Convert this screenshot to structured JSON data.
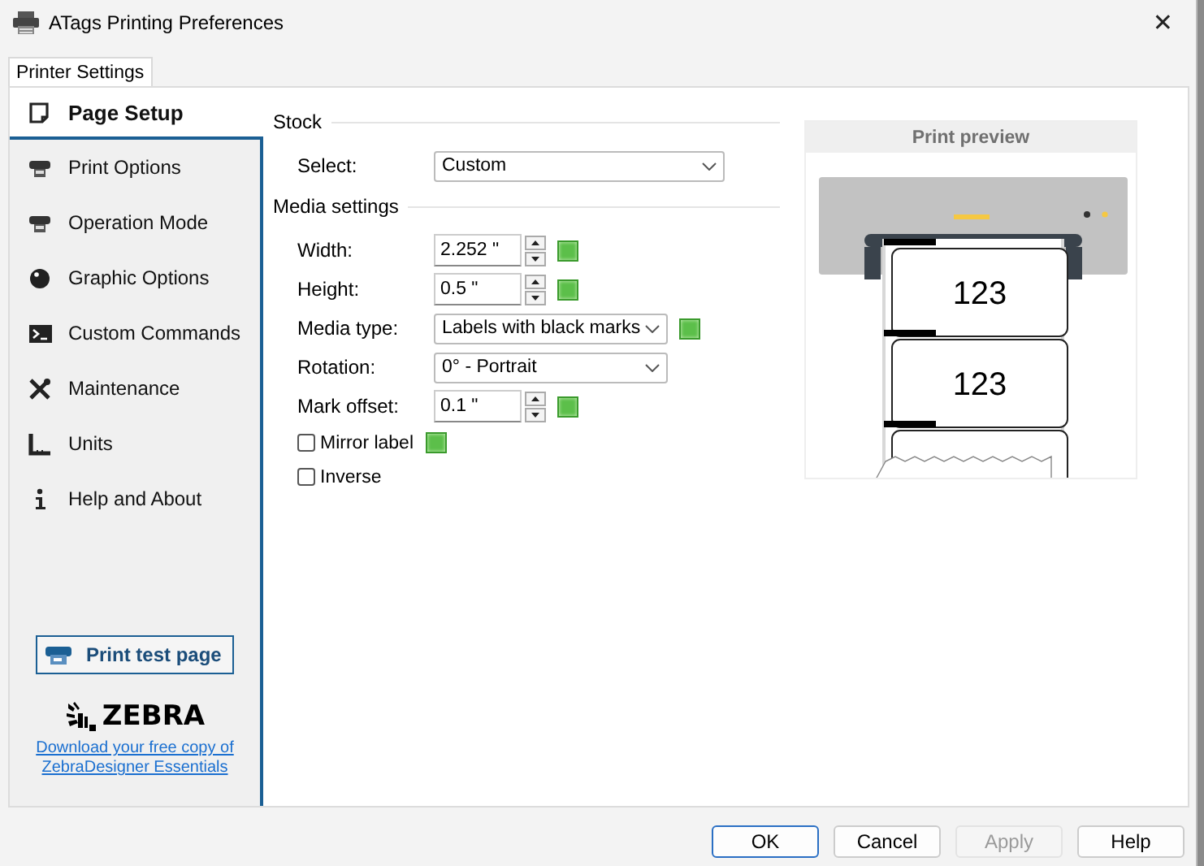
{
  "window": {
    "title": "ATags Printing Preferences",
    "close": "✕"
  },
  "tabs": [
    {
      "label": "Printer Settings",
      "selected": true
    }
  ],
  "sidebar": {
    "items": [
      {
        "label": "Page Setup",
        "selected": true
      },
      {
        "label": "Print Options",
        "selected": false
      },
      {
        "label": "Operation Mode",
        "selected": false
      },
      {
        "label": "Graphic Options",
        "selected": false
      },
      {
        "label": "Custom Commands",
        "selected": false
      },
      {
        "label": "Maintenance",
        "selected": false
      },
      {
        "label": "Units",
        "selected": false
      },
      {
        "label": "Help and About",
        "selected": false
      }
    ],
    "test_button": "Print test page",
    "logo": "ZEBRA",
    "download_link": "Download your free copy of ZebraDesigner Essentials"
  },
  "sections": [
    {
      "title": "Stock",
      "fields": [
        {
          "label": "Select:",
          "kind": "dropdown",
          "value": "Custom",
          "wide": true,
          "indicator": false
        }
      ]
    },
    {
      "title": "Media settings",
      "fields": [
        {
          "label": "Width:",
          "kind": "spinner",
          "value": "2.252 \"",
          "indicator": true
        },
        {
          "label": "Height:",
          "kind": "spinner",
          "value": "0.5 \"",
          "indicator": true
        },
        {
          "label": "Media type:",
          "kind": "dropdown",
          "value": "Labels with black marks",
          "wide": false,
          "indicator": true
        },
        {
          "label": "Rotation:",
          "kind": "dropdown",
          "value": "0° - Portrait",
          "wide": false,
          "indicator": false
        },
        {
          "label": "Mark offset:",
          "kind": "spinner",
          "value": "0.1 \"",
          "indicator": true
        },
        {
          "label": "Mirror label",
          "kind": "checkbox",
          "checked": false,
          "indicator": true
        },
        {
          "label": "Inverse",
          "kind": "checkbox",
          "checked": false,
          "indicator": false
        }
      ]
    }
  ],
  "preview": {
    "title": "Print preview",
    "labels": [
      "123",
      "123"
    ]
  },
  "buttons": [
    {
      "label": "OK",
      "default": true,
      "disabled": false
    },
    {
      "label": "Cancel",
      "default": false,
      "disabled": false
    },
    {
      "label": "Apply",
      "default": false,
      "disabled": true
    },
    {
      "label": "Help",
      "default": false,
      "disabled": false
    }
  ]
}
